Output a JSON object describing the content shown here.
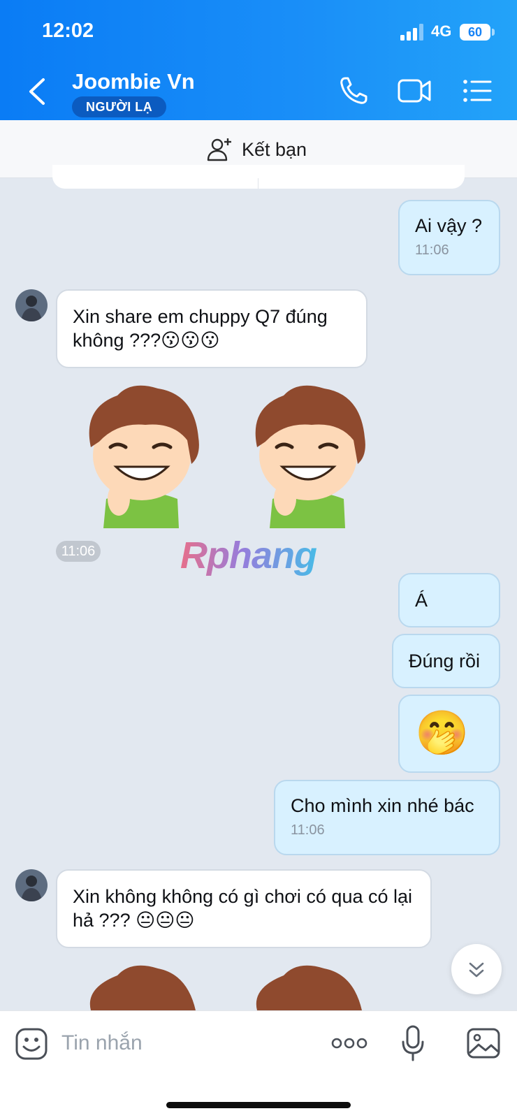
{
  "status": {
    "time": "12:02",
    "network": "4G",
    "battery": "60"
  },
  "header": {
    "contact_name": "Joombie Vn",
    "badge": "NGƯỜI LẠ",
    "icons": [
      "back-icon",
      "phone-icon",
      "video-call-icon",
      "menu-list-icon"
    ]
  },
  "friend_bar": {
    "label": "Kết bạn",
    "icon": "add-friend-icon"
  },
  "messages": {
    "m1": {
      "text": "Ai vậy ?",
      "time": "11:06"
    },
    "m2": {
      "text": "Xin share em chuppy Q7 đúng không ???😗😗😗"
    },
    "sticker_time": "11:06",
    "m3": {
      "text": "Á"
    },
    "m4": {
      "text": "Đúng rồi"
    },
    "m5": {
      "text": "🤭"
    },
    "m6": {
      "text": "Cho mình xin nhé bác",
      "time": "11:06"
    },
    "m7": {
      "text": "Xin không không có gì chơi có qua có lại hả ??? 😐😐😐"
    }
  },
  "watermark": "Rphang",
  "input": {
    "placeholder": "Tin nhắn",
    "icons": [
      "emoji-icon",
      "more-icon",
      "microphone-icon",
      "image-icon"
    ]
  },
  "colors": {
    "header": "#0a7cf5",
    "outgoing_bubble": "#d8f1ff",
    "chat_bg": "#e2e8f0"
  }
}
